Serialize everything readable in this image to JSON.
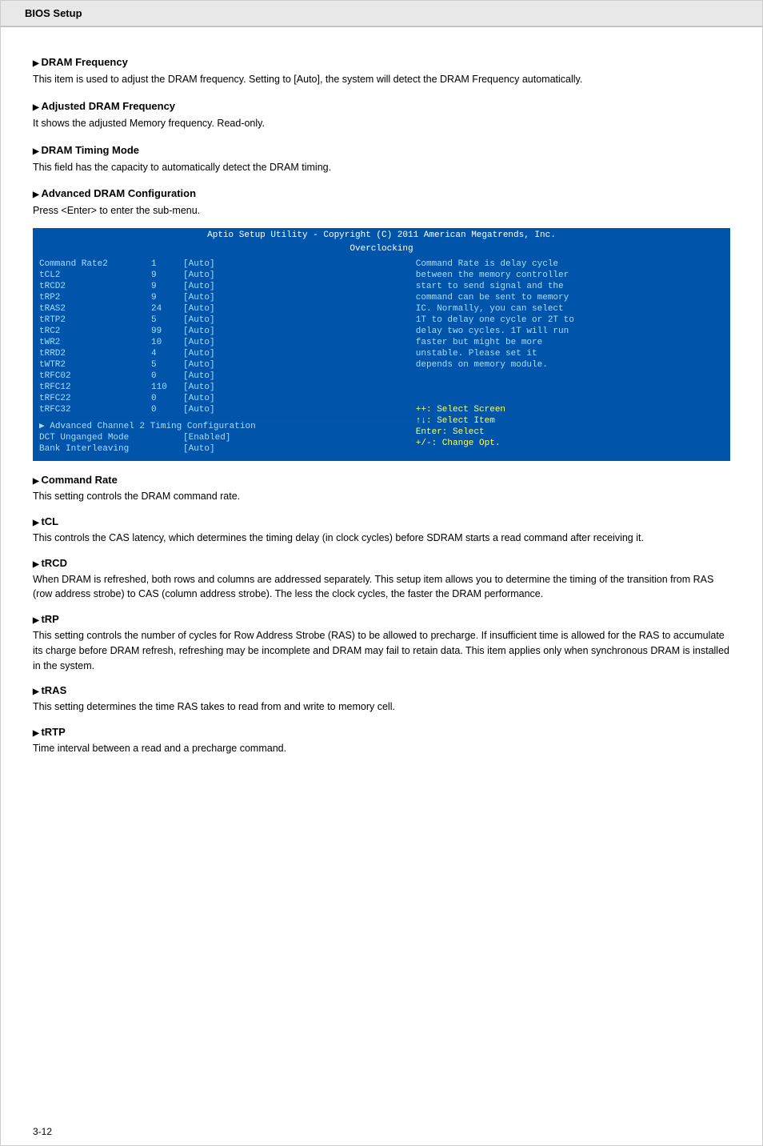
{
  "header": {
    "title": "BIOS Setup"
  },
  "page_number": "3-12",
  "sections": [
    {
      "id": "dram-frequency",
      "title": "DRAM Frequency",
      "body": "This item is used to adjust the DRAM frequency. Setting to [Auto], the system will detect the DRAM Frequency automatically."
    },
    {
      "id": "adjusted-dram",
      "title": "Adjusted DRAM Frequency",
      "body": "It shows the adjusted Memory frequency. Read-only."
    },
    {
      "id": "dram-timing",
      "title": "DRAM Timing Mode",
      "body": "This field has the capacity to automatically detect the DRAM timing."
    },
    {
      "id": "advanced-dram",
      "title": "Advanced DRAM Configuration",
      "body": "Press <Enter> to enter the sub-menu."
    }
  ],
  "bios": {
    "header_line": "Aptio Setup Utility - Copyright (C) 2011 American Megatrends, Inc.",
    "sub_header": "Overclocking",
    "rows": [
      {
        "name": "Command Rate2",
        "num": "1",
        "val": "[Auto]"
      },
      {
        "name": "tCL2",
        "num": "9",
        "val": "[Auto]"
      },
      {
        "name": "tRCD2",
        "num": "9",
        "val": "[Auto]"
      },
      {
        "name": "tRP2",
        "num": "9",
        "val": "[Auto]"
      },
      {
        "name": "tRAS2",
        "num": "24",
        "val": "[Auto]"
      },
      {
        "name": "tRTP2",
        "num": "5",
        "val": "[Auto]"
      },
      {
        "name": "tRC2",
        "num": "99",
        "val": "[Auto]"
      },
      {
        "name": "tWR2",
        "num": "10",
        "val": "[Auto]"
      },
      {
        "name": "tRRD2",
        "num": "4",
        "val": "[Auto]"
      },
      {
        "name": "tWTR2",
        "num": "5",
        "val": "[Auto]"
      },
      {
        "name": "tRFC02",
        "num": "0",
        "val": "[Auto]"
      },
      {
        "name": "tRFC12",
        "num": "110",
        "val": "[Auto]"
      },
      {
        "name": "tRFC22",
        "num": "0",
        "val": "[Auto]"
      },
      {
        "name": "tRFC32",
        "num": "0",
        "val": "[Auto]"
      }
    ],
    "arrow_item": "▶ Advanced Channel 2 Timing Configuration",
    "extra_rows": [
      {
        "name": "DCT Unganged Mode",
        "val": "[Enabled]"
      },
      {
        "name": "Bank Interleaving",
        "val": "[Auto]"
      }
    ],
    "right_text": [
      "Command Rate is delay cycle",
      "between the memory controller",
      "start to send signal and the",
      "command can be sent to memory",
      "IC. Normally, you can select",
      "1T to delay one cycle or 2T to",
      "delay two cycles. 1T will run",
      "faster but might be more",
      "unstable. Please set it",
      "depends on memory module.",
      "",
      "",
      "",
      "++: Select Screen",
      "↑↓: Select Item",
      "Enter: Select",
      "+/-: Change Opt."
    ]
  },
  "sub_sections": [
    {
      "id": "command-rate",
      "title": "Command Rate",
      "body": "This setting controls the DRAM command rate."
    },
    {
      "id": "tcl",
      "title": "tCL",
      "body": "This controls the CAS latency, which determines the timing delay (in clock cycles) before SDRAM starts a read command after receiving it."
    },
    {
      "id": "trcd",
      "title": "tRCD",
      "body": "When DRAM is refreshed, both rows and columns are addressed separately. This setup item allows you to determine the timing of the transition from RAS (row address strobe) to CAS (column address strobe). The less the clock cycles, the faster the DRAM performance."
    },
    {
      "id": "trp",
      "title": "tRP",
      "body": "This setting controls the number of cycles for Row Address Strobe (RAS) to be allowed to precharge. If insufficient time is allowed for the RAS to accumulate its charge before DRAM refresh, refreshing may be incomplete and DRAM may fail to retain data. This item applies only when synchronous DRAM is installed in the system."
    },
    {
      "id": "tras",
      "title": "tRAS",
      "body": "This setting determines the time RAS takes to read from and write to memory cell."
    },
    {
      "id": "trtp",
      "title": "tRTP",
      "body": "Time interval between a read and a precharge command."
    }
  ]
}
